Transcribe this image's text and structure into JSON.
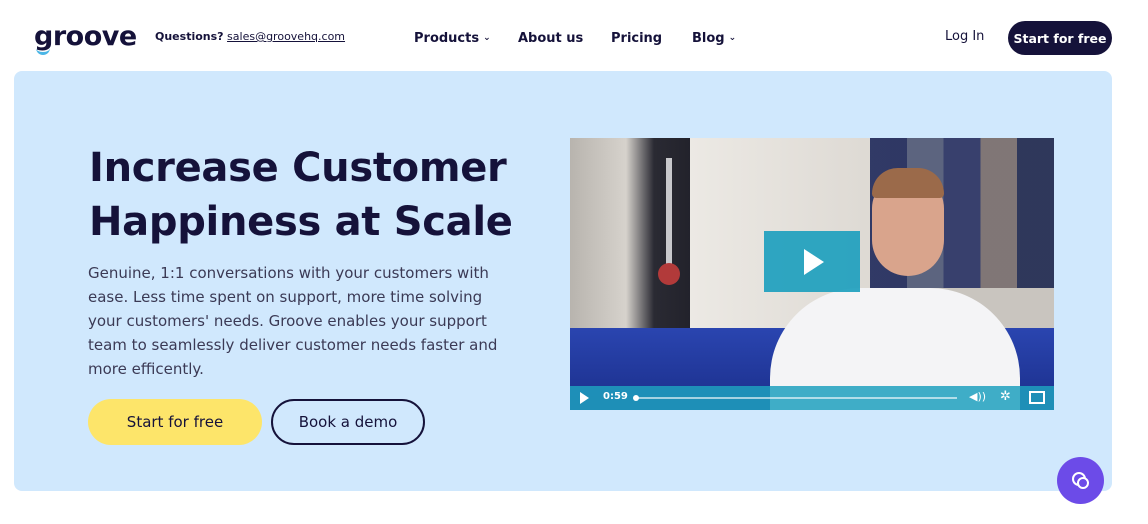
{
  "header": {
    "logo_text": "groove",
    "questions_label": "Questions?",
    "questions_email": "sales@groovehq.com",
    "nav": [
      {
        "label": "Products",
        "has_dropdown": true
      },
      {
        "label": "About us",
        "has_dropdown": false
      },
      {
        "label": "Pricing",
        "has_dropdown": false
      },
      {
        "label": "Blog",
        "has_dropdown": true
      }
    ],
    "login_label": "Log In",
    "start_label": "Start for free"
  },
  "hero": {
    "headline": "Increase Customer Happiness at Scale",
    "subtext": "Genuine, 1:1 conversations with your customers with ease. Less time spent on support, more time solving your customers' needs. Groove enables your support team to seamlessly deliver customer needs faster and more efficently.",
    "primary_button": "Start for free",
    "secondary_button": "Book a demo"
  },
  "video": {
    "time": "0:59",
    "progress": 0.0,
    "icons": [
      "play-icon",
      "volume-icon",
      "settings-gear-icon",
      "fullscreen-icon"
    ]
  },
  "chat": {
    "icon": "chat-bubble-icon"
  },
  "colors": {
    "brand_dark": "#15123a",
    "hero_bg": "#d0e8fd",
    "primary_button": "#fde56a",
    "video_accent": "#1ea0be",
    "chat_button": "#6c4be8"
  }
}
